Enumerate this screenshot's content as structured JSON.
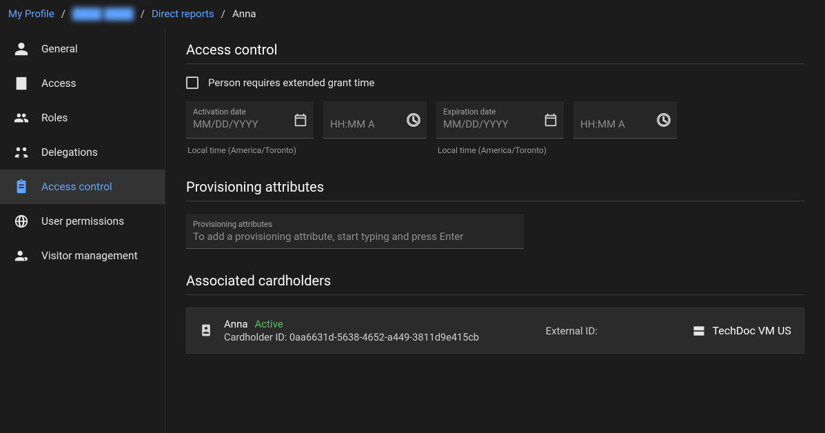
{
  "breadcrumb": {
    "root": "My Profile",
    "redacted": "████ ████",
    "mid": "Direct reports",
    "current": "Anna"
  },
  "sidebar": {
    "items": [
      {
        "label": "General"
      },
      {
        "label": "Access"
      },
      {
        "label": "Roles"
      },
      {
        "label": "Delegations"
      },
      {
        "label": "Access control"
      },
      {
        "label": "User permissions"
      },
      {
        "label": "Visitor management"
      }
    ]
  },
  "sections": {
    "access_control": {
      "title": "Access control",
      "checkbox_label": "Person requires extended grant time",
      "activation": {
        "label": "Activation date",
        "placeholder": "MM/DD/YYYY",
        "time_placeholder": "HH:MM A",
        "helper": "Local time (America/Toronto)"
      },
      "expiration": {
        "label": "Expiration date",
        "placeholder": "MM/DD/YYYY",
        "time_placeholder": "HH:MM A",
        "helper": "Local time (America/Toronto)"
      }
    },
    "provisioning": {
      "title": "Provisioning attributes",
      "field_label": "Provisioning attributes",
      "placeholder": "To add a provisioning attribute, start typing and press Enter"
    },
    "cardholders": {
      "title": "Associated cardholders",
      "entry": {
        "name": "Anna",
        "status": "Active",
        "id_label": "Cardholder ID: ",
        "id_value": "0aa6631d-5638-4652-a449-3811d9e415cb",
        "external_label": "External ID:",
        "source": "TechDoc VM US"
      }
    }
  }
}
